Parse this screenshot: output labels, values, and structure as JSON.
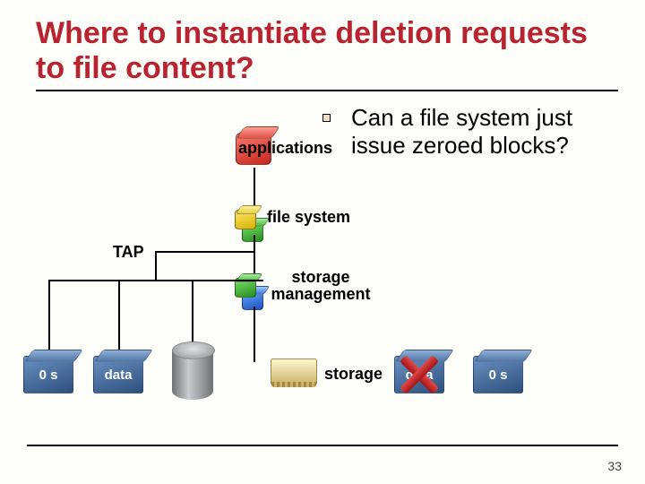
{
  "title": "Where to instantiate deletion requests to file content?",
  "bullet": {
    "text": "Can a file system just issue zeroed blocks?"
  },
  "labels": {
    "applications": "applications",
    "file_system": "file system",
    "tap": "TAP",
    "storage_mgmt_line1": "storage",
    "storage_mgmt_line2": "management",
    "storage": "storage"
  },
  "slabs": {
    "left_zeros": "0 s",
    "left_data": "data",
    "right_data": "data",
    "right_zeros": "0 s"
  },
  "page_number": "33"
}
